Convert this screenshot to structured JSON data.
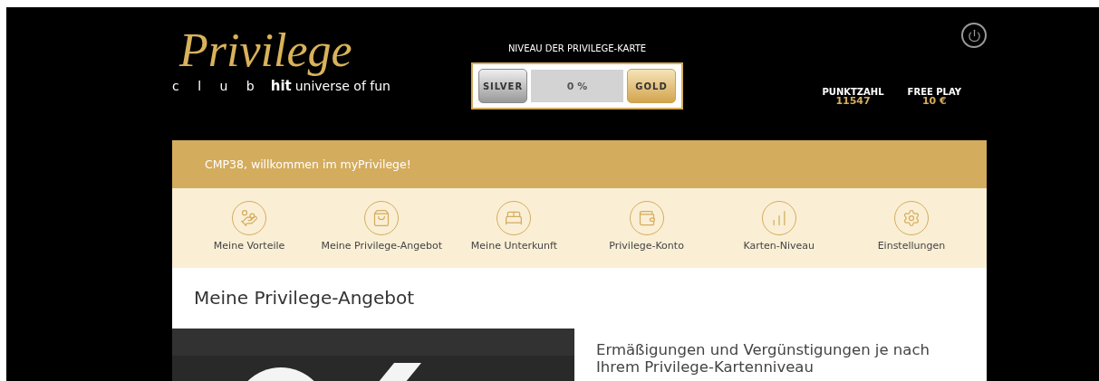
{
  "logo": {
    "script": "Privilege",
    "club": "c l u b",
    "brand": "hit",
    "tagline": "universe of fun"
  },
  "card_level": {
    "title": "NIVEAU DER PRIVILEGE-KARTE",
    "from": "SILVER",
    "to": "GOLD",
    "level": 0,
    "reading": "0 %"
  },
  "stats": [
    {
      "label": "PUNKTZAHL",
      "value": "11547"
    },
    {
      "label": "FREE PLAY",
      "value": "10 €"
    }
  ],
  "welcome": "CMP38, willkommen im myPrivilege!",
  "nav": [
    {
      "label": "Meine Vorteile",
      "kind": "hand"
    },
    {
      "label": "Meine Privilege-Angebot",
      "kind": "bag"
    },
    {
      "label": "Meine Unterkunft",
      "kind": "bed"
    },
    {
      "label": "Privilege-Konto",
      "kind": "wallet"
    },
    {
      "label": "Karten-Niveau",
      "kind": "chart"
    },
    {
      "label": "Einstellungen",
      "kind": "gear"
    }
  ],
  "page_title": "Meine Privilege-Angebot",
  "offer": {
    "text": "Ermäßigungen und Vergünstigungen je nach Ihrem Privilege-Kartenniveau"
  }
}
